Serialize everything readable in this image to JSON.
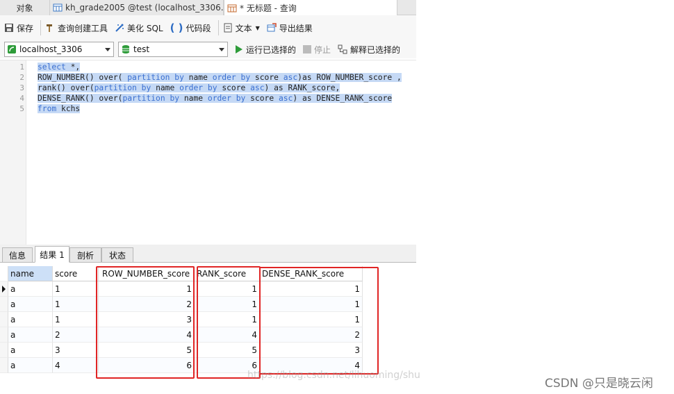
{
  "tabs": [
    {
      "label": "对象"
    },
    {
      "label": "kh_grade2005 @test (localhost_3306..."
    },
    {
      "label": "* 无标题 - 查询"
    }
  ],
  "toolbar": {
    "save": "保存",
    "query_builder": "查询创建工具",
    "beautify": "美化 SQL",
    "snippet": "代码段",
    "text": "文本",
    "export": "导出结果"
  },
  "connection": {
    "server": "localhost_3306",
    "database": "test",
    "run_selected": "运行已选择的",
    "stop": "停止",
    "explain_selected": "解释已选择的"
  },
  "editor": {
    "line_numbers": [
      "1",
      "2",
      "3",
      "4",
      "5"
    ],
    "lines": [
      "select *,",
      "ROW_NUMBER() over( partition by name order by score asc)as ROW_NUMBER_score ,",
      "rank() over(partition by name order by score asc) as RANK_score,",
      "DENSE_RANK() over(partition by name order by score asc) as DENSE_RANK_score",
      "from kchs"
    ]
  },
  "result_tabs": [
    "信息",
    "结果 1",
    "剖析",
    "状态"
  ],
  "grid": {
    "columns": [
      "name",
      "score",
      "ROW_NUMBER_score",
      "RANK_score",
      "DENSE_RANK_score"
    ],
    "rows": [
      [
        "a",
        "1",
        "1",
        "1",
        "1"
      ],
      [
        "a",
        "1",
        "2",
        "1",
        "1"
      ],
      [
        "a",
        "1",
        "3",
        "1",
        "1"
      ],
      [
        "a",
        "2",
        "4",
        "4",
        "2"
      ],
      [
        "a",
        "3",
        "5",
        "5",
        "3"
      ],
      [
        "a",
        "4",
        "6",
        "6",
        "4"
      ]
    ]
  },
  "watermark": "https://blog.csdn.net/lihuoming/shu",
  "credit": "CSDN @只是晓云闲",
  "colors": {
    "highlight_red": "#e02424",
    "selection": "#c5d9f5",
    "keyword": "#3a6fd0"
  }
}
